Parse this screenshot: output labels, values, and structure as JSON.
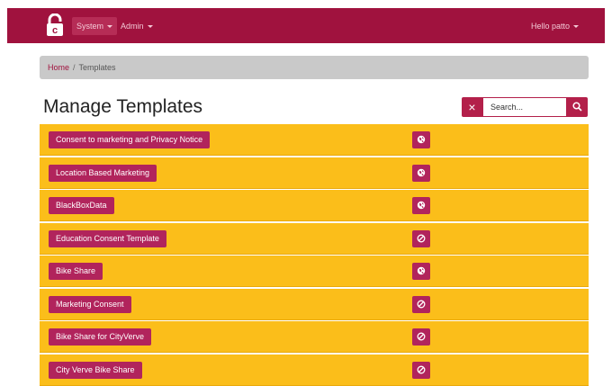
{
  "navbar": {
    "logo_icon": "padlock-c-logo",
    "menus": [
      {
        "label": "System"
      },
      {
        "label": "Admin"
      }
    ],
    "user_menu": "Hello patto"
  },
  "breadcrumb": {
    "home": "Home",
    "separator": "/",
    "current": "Templates"
  },
  "page": {
    "title": "Manage Templates"
  },
  "search": {
    "clear_label": "×",
    "placeholder": "Search...",
    "button_icon": "search-icon"
  },
  "colors": {
    "brand": "#a0123e",
    "row_bg": "#fbbe1a",
    "button": "#b1245c"
  },
  "templates": [
    {
      "name": "Consent to marketing and Privacy Notice",
      "status_icon": "globe-icon"
    },
    {
      "name": "Location Based Marketing",
      "status_icon": "globe-icon"
    },
    {
      "name": "BlackBoxData",
      "status_icon": "globe-icon"
    },
    {
      "name": "Education Consent Template",
      "status_icon": "ban-icon"
    },
    {
      "name": "Bike Share",
      "status_icon": "globe-icon"
    },
    {
      "name": "Marketing Consent",
      "status_icon": "ban-icon"
    },
    {
      "name": "Bike Share for CityVerve",
      "status_icon": "ban-icon"
    },
    {
      "name": "City Verve Bike Share",
      "status_icon": "ban-icon"
    }
  ]
}
